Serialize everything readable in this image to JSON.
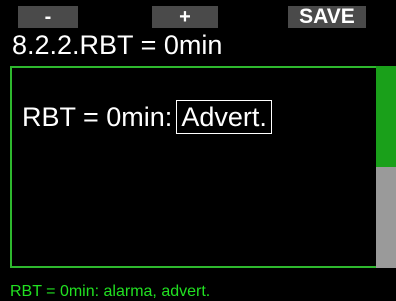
{
  "softkeys": {
    "minus": "-",
    "plus": "+",
    "save": "SAVE"
  },
  "title": "8.2.2.RBT = 0min",
  "setting": {
    "label": "RBT = 0min:",
    "value": "Advert."
  },
  "scrollbar": {
    "position_fraction": 0.5
  },
  "status_text": "RBT = 0min: alarma, advert.",
  "colors": {
    "accent": "#2eb82e",
    "status_text": "#21e021",
    "background": "#000000"
  }
}
